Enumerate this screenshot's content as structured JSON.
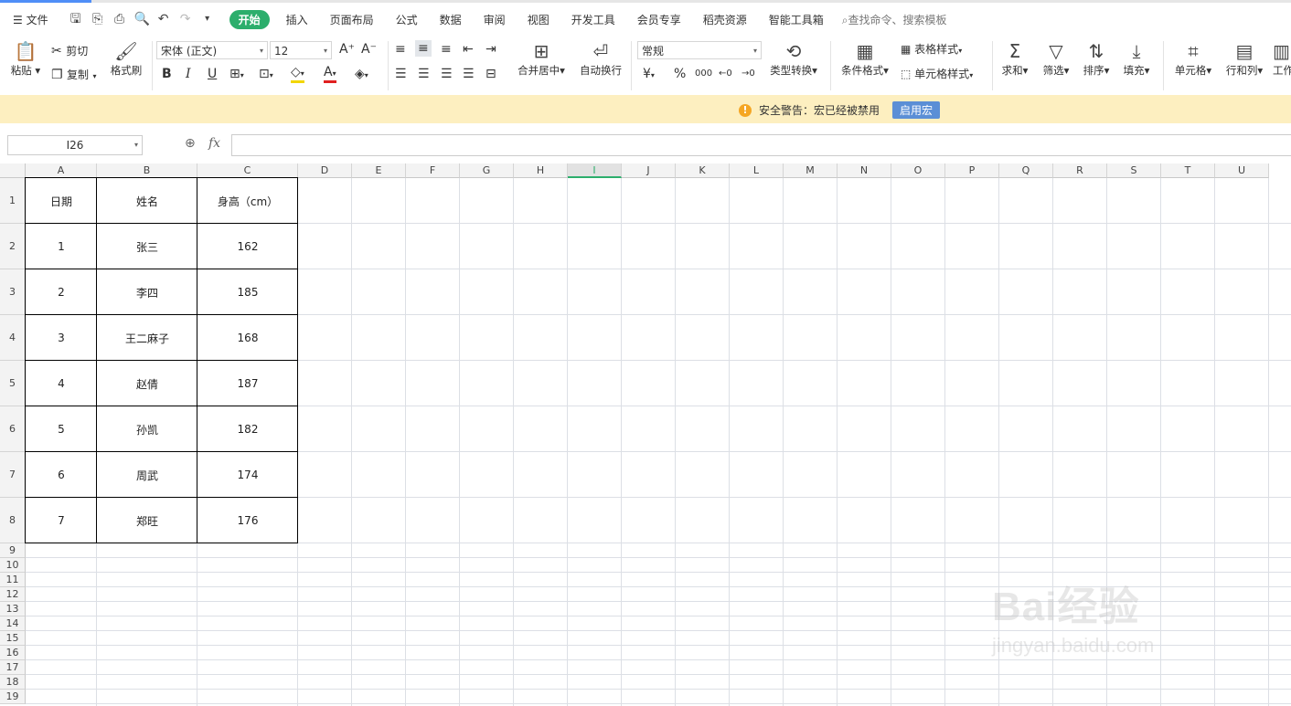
{
  "menubar": {
    "file": "文件",
    "tabs": [
      "开始",
      "插入",
      "页面布局",
      "公式",
      "数据",
      "审阅",
      "视图",
      "开发工具",
      "会员专享",
      "稻壳资源",
      "智能工具箱"
    ],
    "active_tab": "开始",
    "search_placeholder": "查找命令、搜索模板"
  },
  "ribbon": {
    "paste": "粘贴",
    "cut": "剪切",
    "copy": "复制",
    "format_painter": "格式刷",
    "font_name": "宋体 (正文)",
    "font_size": "12",
    "merge_center": "合并居中",
    "wrap_text": "自动换行",
    "number_format": "常规",
    "type_convert": "类型转换",
    "cond_format": "条件格式",
    "table_style": "表格样式",
    "cell_style": "单元格样式",
    "sum": "求和",
    "filter": "筛选",
    "sort": "排序",
    "fill": "填充",
    "cell": "单元格",
    "row_col": "行和列",
    "worksheet": "工作"
  },
  "security": {
    "message": "安全警告：宏已经被禁用",
    "enable_button": "启用宏"
  },
  "formula_bar": {
    "name_box": "I26",
    "fx": "fx",
    "content": ""
  },
  "columns": [
    "A",
    "B",
    "C",
    "D",
    "E",
    "F",
    "G",
    "H",
    "I",
    "J",
    "K",
    "L",
    "M",
    "N",
    "O",
    "P",
    "Q",
    "R",
    "S",
    "T",
    "U"
  ],
  "selected_column": "I",
  "rows": [
    "1",
    "2",
    "3",
    "4",
    "5",
    "6",
    "7",
    "8",
    "9",
    "10",
    "11",
    "12",
    "13",
    "14",
    "15",
    "16",
    "17",
    "18",
    "19"
  ],
  "table": {
    "headers": [
      "日期",
      "姓名",
      "身高（cm）"
    ],
    "rows": [
      [
        "1",
        "张三",
        "162"
      ],
      [
        "2",
        "李四",
        "185"
      ],
      [
        "3",
        "王二麻子",
        "168"
      ],
      [
        "4",
        "赵倩",
        "187"
      ],
      [
        "5",
        "孙凯",
        "182"
      ],
      [
        "6",
        "周武",
        "174"
      ],
      [
        "7",
        "郑旺",
        "176"
      ]
    ]
  },
  "watermark": {
    "logo": "Bai经验",
    "url": "jingyan.baidu.com"
  }
}
